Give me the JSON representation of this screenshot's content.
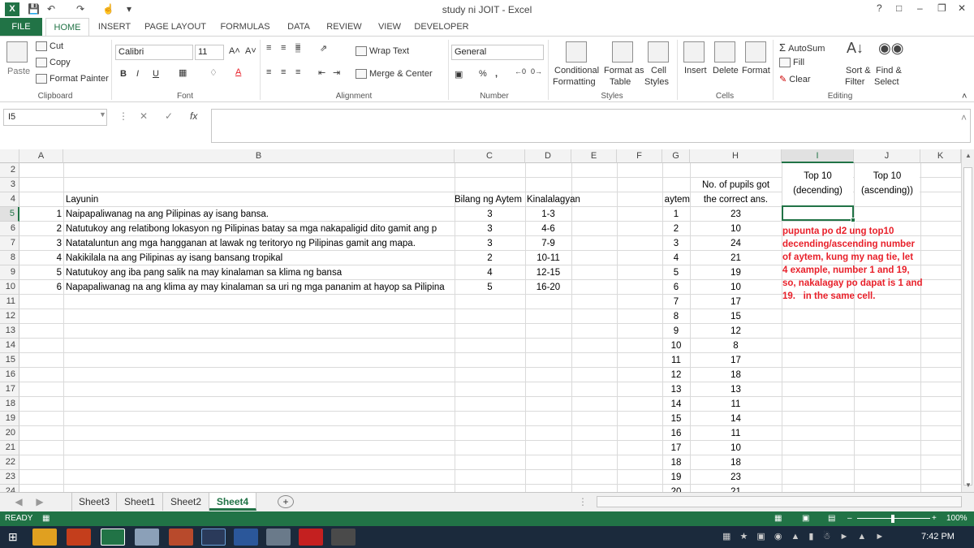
{
  "window": {
    "title": "study ni JOIT - Excel",
    "help": "?",
    "controls": [
      "□",
      "–",
      "❐",
      "✕"
    ]
  },
  "ribbon_tabs": [
    "FILE",
    "HOME",
    "INSERT",
    "PAGE LAYOUT",
    "FORMULAS",
    "DATA",
    "REVIEW",
    "VIEW",
    "DEVELOPER"
  ],
  "clipboard": {
    "paste": "Paste",
    "cut": "Cut",
    "copy": "Copy",
    "format_painter": "Format Painter",
    "label": "Clipboard"
  },
  "font": {
    "name": "Calibri",
    "size": "11",
    "bold": "B",
    "italic": "I",
    "underline": "U",
    "grow": "A˄",
    "shrink": "A˅",
    "color_a": "A",
    "label": "Font"
  },
  "alignment": {
    "wrap_text": "Wrap Text",
    "merge_center": "Merge & Center",
    "label": "Alignment"
  },
  "number": {
    "format": "General",
    "percent": "%",
    "comma": ",",
    "label": "Number"
  },
  "styles": {
    "conditional": "Conditional",
    "formatting": "Formatting",
    "format_as": "Format as",
    "table": "Table",
    "cell": "Cell",
    "styles": "Styles",
    "label": "Styles"
  },
  "cells": {
    "insert": "Insert",
    "delete": "Delete",
    "format": "Format",
    "label": "Cells"
  },
  "editing": {
    "autosum": "AutoSum",
    "fill": "Fill",
    "clear": "Clear",
    "sort_filter": "Sort &",
    "filter": "Filter",
    "find_select": "Find &",
    "select": "Select",
    "label": "Editing"
  },
  "formula_bar": {
    "name_box": "I5",
    "fx": "fx",
    "value": ""
  },
  "columns": [
    "A",
    "B",
    "C",
    "D",
    "E",
    "F",
    "G",
    "H",
    "I",
    "J",
    "K"
  ],
  "rows": [
    "2",
    "3",
    "4",
    "5",
    "6",
    "7",
    "8",
    "9",
    "10",
    "11",
    "12",
    "13",
    "14",
    "15",
    "16",
    "17",
    "18",
    "19",
    "20",
    "21",
    "22",
    "23",
    "24"
  ],
  "headers": {
    "layunin": "Layunin",
    "bilang": "Bilang ng Aytem",
    "kinalalagyan": "Kinalalagyan",
    "aytem": "aytem",
    "pupils_1": "No. of pupils got",
    "pupils_2": "the correct ans.",
    "top10_desc_1": "Top 10",
    "top10_desc_2": "(decending)",
    "top10_asc_1": "Top 10",
    "top10_asc_2": "(ascending))"
  },
  "objectives": [
    {
      "no": "1",
      "text": "Naipapaliwanag na ang Pilipinas ay isang bansa.",
      "count": "3",
      "loc": "1-3"
    },
    {
      "no": "2",
      "text": "Natutukoy ang relatibong lokasyon ng Pilipinas batay sa mga nakapaligid dito gamit ang p",
      "count": "3",
      "loc": "4-6"
    },
    {
      "no": "3",
      "text": "Natataluntun ang mga hangganan at lawak ng teritoryo ng Pilipinas gamit ang mapa.",
      "count": "3",
      "loc": "7-9"
    },
    {
      "no": "4",
      "text": "Nakikilala na ang Pilipinas ay isang bansang tropikal",
      "count": "2",
      "loc": "10-11"
    },
    {
      "no": "5",
      "text": "Natutukoy ang iba pang salik na may kinalaman sa klima ng bansa",
      "count": "4",
      "loc": "12-15"
    },
    {
      "no": "6",
      "text": "Napapaliwanag na ang klima ay may kinalaman sa uri ng mga pananim at hayop sa Pilipina",
      "count": "5",
      "loc": "16-20"
    }
  ],
  "items": [
    {
      "aytem": "1",
      "pupils": "23"
    },
    {
      "aytem": "2",
      "pupils": "10"
    },
    {
      "aytem": "3",
      "pupils": "24"
    },
    {
      "aytem": "4",
      "pupils": "21"
    },
    {
      "aytem": "5",
      "pupils": "19"
    },
    {
      "aytem": "6",
      "pupils": "10"
    },
    {
      "aytem": "7",
      "pupils": "17"
    },
    {
      "aytem": "8",
      "pupils": "15"
    },
    {
      "aytem": "9",
      "pupils": "12"
    },
    {
      "aytem": "10",
      "pupils": "8"
    },
    {
      "aytem": "11",
      "pupils": "17"
    },
    {
      "aytem": "12",
      "pupils": "18"
    },
    {
      "aytem": "13",
      "pupils": "13"
    },
    {
      "aytem": "14",
      "pupils": "11"
    },
    {
      "aytem": "15",
      "pupils": "14"
    },
    {
      "aytem": "16",
      "pupils": "11"
    },
    {
      "aytem": "17",
      "pupils": "10"
    },
    {
      "aytem": "18",
      "pupils": "18"
    },
    {
      "aytem": "19",
      "pupils": "23"
    },
    {
      "aytem": "20",
      "pupils": "21"
    }
  ],
  "note": "pupunta po d2 ung top10\ndecending/ascending number\nof aytem, kung my nag tie, let\n4 example, number 1 and 19,\nso, nakalagay po dapat is 1 and\n19.   in the same cell.",
  "sheets": [
    "Sheet3",
    "Sheet1",
    "Sheet2",
    "Sheet4"
  ],
  "active_sheet": "Sheet4",
  "add_sheet": "+",
  "status": {
    "mode": "READY",
    "zoom": "100%",
    "minus": "–",
    "plus": "+"
  },
  "clock": "7:42 PM",
  "colors": {
    "excel_green": "#217346",
    "note_red": "#e8202a"
  }
}
